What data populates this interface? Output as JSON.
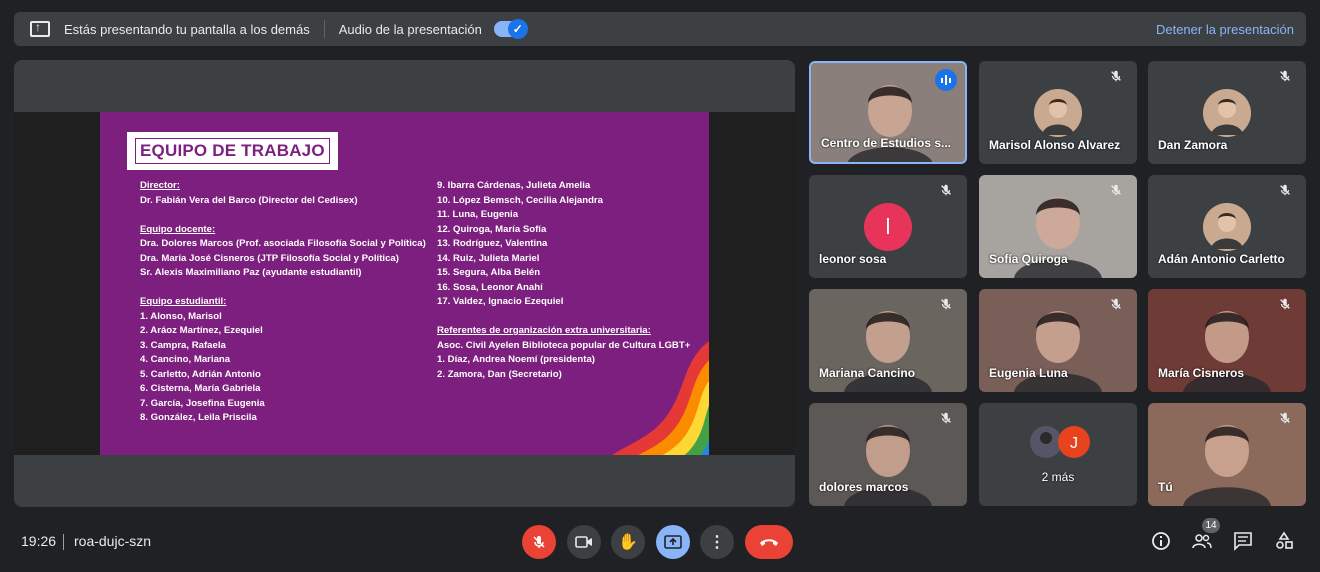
{
  "topbar": {
    "presenting_text": "Estás presentando tu pantalla a los demás",
    "audio_label": "Audio de la presentación",
    "audio_enabled": true,
    "stop_label": "Detener la presentación"
  },
  "slide": {
    "title": "EQUIPO DE TRABAJO",
    "left_column": [
      {
        "text": "Director:",
        "underline": true
      },
      {
        "text": "Dr. Fabián Vera del Barco (Director del Cedisex)"
      },
      {
        "text": "",
        "gap": true
      },
      {
        "text": "Equipo docente:",
        "underline": true
      },
      {
        "text": "Dra. Dolores Marcos (Prof. asociada Filosofía Social y Política)"
      },
      {
        "text": "Dra. María José Cisneros (JTP Filosofía Social y Política)"
      },
      {
        "text": "Sr. Alexis Maximiliano Paz (ayudante estudiantil)"
      },
      {
        "text": "",
        "gap": true
      },
      {
        "text": "Equipo estudiantil:",
        "underline": true
      },
      {
        "text": "1. Alonso, Marisol"
      },
      {
        "text": "2. Aráoz Martínez, Ezequiel"
      },
      {
        "text": "3. Campra, Rafaela"
      },
      {
        "text": "4. Cancino, Mariana"
      },
      {
        "text": "5. Carletto, Adrián Antonio"
      },
      {
        "text": "6. Cisterna, María Gabriela"
      },
      {
        "text": "7. García, Josefina Eugenia"
      },
      {
        "text": "8. González, Leila Priscila"
      }
    ],
    "right_column": [
      {
        "text": "9. Ibarra Cárdenas, Julieta Amelia"
      },
      {
        "text": "10. López Bemsch, Cecilia Alejandra"
      },
      {
        "text": "11. Luna, Eugenia"
      },
      {
        "text": "12. Quiroga, María Sofía"
      },
      {
        "text": "13. Rodríguez, Valentina"
      },
      {
        "text": "14. Ruiz, Julieta Mariel"
      },
      {
        "text": "15. Segura, Alba Belén"
      },
      {
        "text": "16. Sosa, Leonor Anahí"
      },
      {
        "text": "17. Valdez, Ignacio Ezequiel"
      },
      {
        "text": "",
        "gap": true
      },
      {
        "text": "Referentes de organización extra universitaria:",
        "underline": true
      },
      {
        "text": "Asoc. Civil Ayelen Biblioteca popular de Cultura LGBT+"
      },
      {
        "text": "1. Díaz, Andrea Noemí (presidenta)"
      },
      {
        "text": "2. Zamora, Dan (Secretario)"
      }
    ]
  },
  "participants": [
    {
      "name": "Centro de Estudios s...",
      "mic": "speaking",
      "type": "camera",
      "bg": "#8a7f7a"
    },
    {
      "name": "Marisol Alonso Alvarez",
      "mic": "muted",
      "type": "photo",
      "bg": "#3c4043"
    },
    {
      "name": "Dan Zamora",
      "mic": "muted",
      "type": "photo",
      "bg": "#3c4043"
    },
    {
      "name": "leonor sosa",
      "mic": "muted",
      "type": "initial",
      "initial": "l",
      "bg": "#3c4043",
      "avatar_color": "#e8345a"
    },
    {
      "name": "Sofía Quiroga",
      "mic": "muted",
      "type": "camera",
      "bg": "#a7a39e"
    },
    {
      "name": "Adán Antonio Carletto",
      "mic": "muted",
      "type": "photo",
      "bg": "#3c4043"
    },
    {
      "name": "Mariana Cancino",
      "mic": "muted",
      "type": "camera",
      "bg": "#6b6560"
    },
    {
      "name": "Eugenia Luna",
      "mic": "muted",
      "type": "camera",
      "bg": "#7a5e58"
    },
    {
      "name": "María Cisneros",
      "mic": "muted",
      "type": "camera",
      "bg": "#6e3b36"
    },
    {
      "name": "dolores marcos",
      "mic": "muted",
      "type": "camera",
      "bg": "#5c5855"
    },
    {
      "name": "2 más",
      "mic": "none",
      "type": "more",
      "bg": "#3c4043"
    },
    {
      "name": "Tú",
      "mic": "muted",
      "type": "camera",
      "bg": "#8b6a5c"
    }
  ],
  "bottombar": {
    "time": "19:26",
    "meeting_code": "roa-dujc-szn",
    "participant_count": "14"
  },
  "icons": {
    "mic_off": "mic-off-icon",
    "camera": "camera-icon",
    "hand": "hand-icon",
    "present": "present-icon",
    "more": "more-vert-icon",
    "hangup": "hangup-icon",
    "info": "info-icon",
    "people": "people-icon",
    "chat": "chat-icon",
    "activities": "activities-icon"
  },
  "colors": {
    "accent": "#8ab4f8",
    "danger": "#ea4335",
    "slide_bg": "#7d1f7e"
  }
}
